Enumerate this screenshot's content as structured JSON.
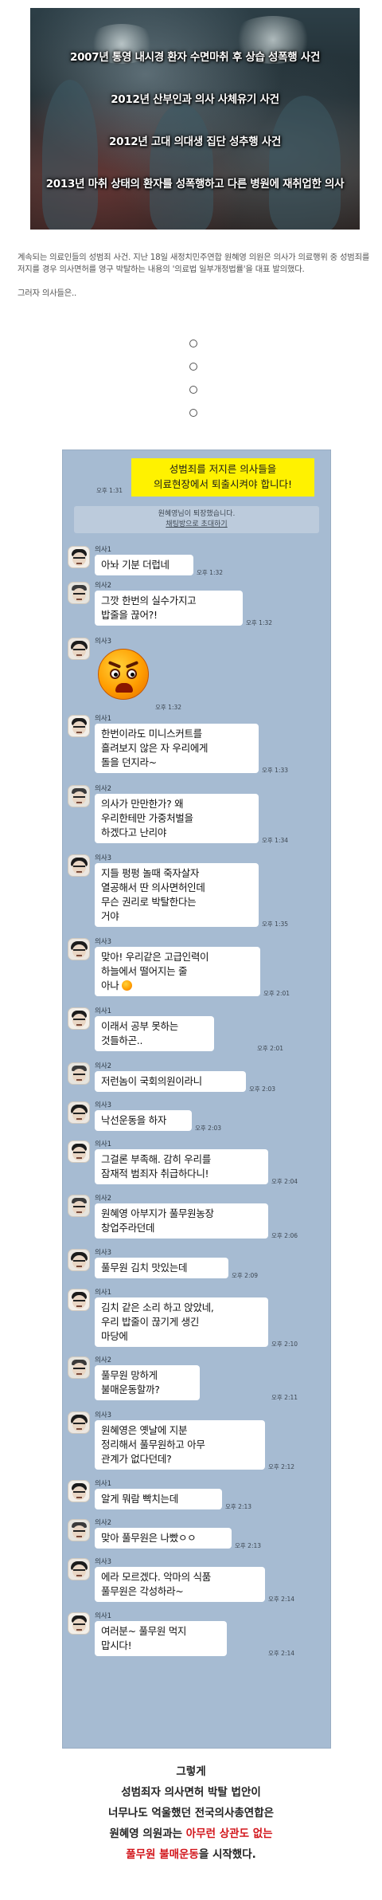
{
  "banner": {
    "lines": [
      "2007년 통영 내시경 환자 수면마취 후 상습 성폭행 사건",
      "2012년 산부인과 의사 사체유기 사건",
      "2012년 고대 의대생 집단 성추행 사건",
      "2013년 마취 상태의 환자를 성폭행하고 다른 병원에 재취업한 의사"
    ]
  },
  "article": {
    "paragraph1": "계속되는 의료인들의 성범죄 사건. 지난 18일 새정치민주연합 원혜영 의원은 의사가 의료행위 중 성범죄를 저지를 경우 의사면허를 영구 박탈하는 내용의 '의료법 일부개정법률'을 대표 발의했다.",
    "paragraph2": "그러자 의사들은.."
  },
  "chat": {
    "notice": {
      "text": "성범죄를 저지른 의사들을\n의료현장에서 퇴출시켜야 합니다!",
      "time": "오후 1:31"
    },
    "invite": {
      "line1": "원혜영님이 퇴장했습니다.",
      "line2": "채팅방으로 초대하기"
    },
    "messages": [
      {
        "sender": "의사1",
        "text": "아놔 기분 더럽네",
        "time": "오후 1:32"
      },
      {
        "sender": "의사2",
        "text": "그깟 한번의 실수가지고\n밥줄을 끊어?!",
        "time": "오후 1:32"
      },
      {
        "sender": "의사3",
        "text": "",
        "time": "오후 1:32"
      },
      {
        "sender": "의사1",
        "text": "한번이라도 미니스커트를\n흘려보지 않은 자 우리에게\n돌을 던지라~",
        "time": "오후 1:33"
      },
      {
        "sender": "의사2",
        "text": "의사가 만만한가? 왜\n우리한테만 가중처벌을\n하겠다고 난리야",
        "time": "오후 1:34"
      },
      {
        "sender": "의사3",
        "text": "지들 펑펑 놀때 죽자살자\n열공해서 딴 의사면허인데\n무슨 권리로 박탈한다는\n거야",
        "time": "오후 1:35"
      },
      {
        "sender": "의사3",
        "text": "맞아! 우리같은 고급인력이\n하늘에서 떨어지는 줄\n아나",
        "time": "오후 2:01"
      },
      {
        "sender": "의사1",
        "text": "이래서 공부 못하는\n것들하곤..",
        "time": "오후 2:01"
      },
      {
        "sender": "의사2",
        "text": "저런놈이 국회의원이라니",
        "time": "오후 2:03"
      },
      {
        "sender": "의사3",
        "text": "낙선운동을 하자",
        "time": "오후 2:03"
      },
      {
        "sender": "의사1",
        "text": "그걸론 부족해. 감히 우리를\n잠재적 범죄자 취급하다니!",
        "time": "오후 2:04"
      },
      {
        "sender": "의사2",
        "text": "원혜영 아부지가 풀무원농장\n창업주라던데",
        "time": "오후 2:06"
      },
      {
        "sender": "의사3",
        "text": "풀무원 김치 맛있는데",
        "time": "오후 2:09"
      },
      {
        "sender": "의사1",
        "text": "김치 같은 소리 하고 앉았네,\n우리 밥줄이 끊기게 생긴\n마당에",
        "time": "오후 2:10"
      },
      {
        "sender": "의사2",
        "text": "풀무원 망하게\n불매운동할까?",
        "time": "오후 2:11"
      },
      {
        "sender": "의사3",
        "text": "원혜영은 옛날에 지분\n정리해서 풀무원하고 아무\n관계가 없다던데?",
        "time": "오후 2:12"
      },
      {
        "sender": "의사1",
        "text": "알게 뭐람 빡치는데",
        "time": "오후 2:13"
      },
      {
        "sender": "의사2",
        "text": "맞아 풀무원은 나빴ㅇㅇ",
        "time": "오후 2:13"
      },
      {
        "sender": "의사3",
        "text": "에라 모르겠다. 악마의 식품\n풀무원은 각성하라~",
        "time": "오후 2:14"
      },
      {
        "sender": "의사1",
        "text": "여러분~ 풀무원 먹지\n맙시다!",
        "time": "오후 2:14"
      }
    ]
  },
  "conclusion": {
    "line1": "그렇게",
    "line2": "성범죄자 의사면허 박탈 법안이",
    "line3": "너무나도 억울했던 전국의사총연합은",
    "line4_a": "원혜영 의원과는 ",
    "line4_red": "아무런 상관도 없는",
    "line5_red": "풀무원 불매운동",
    "line5_b": "을 시작했다."
  },
  "colors": {
    "chat_background": "#a6bbd2",
    "notice_background": "#fff200",
    "emphasis_red": "#d2161c"
  }
}
